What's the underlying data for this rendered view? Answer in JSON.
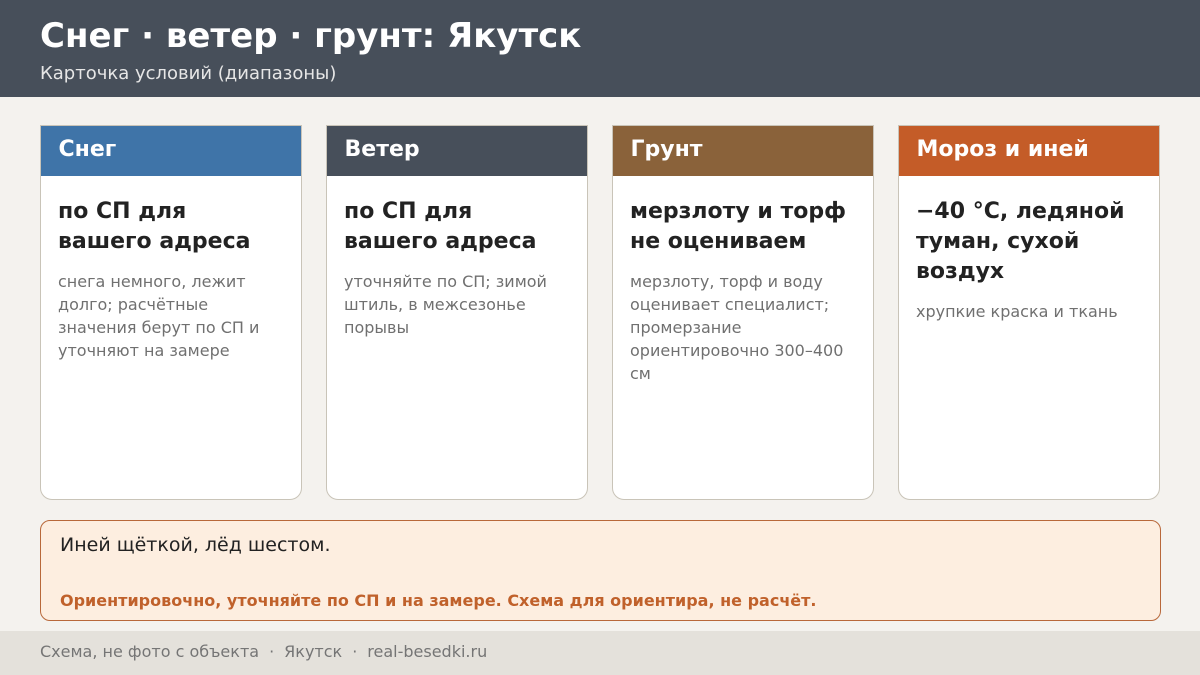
{
  "header": {
    "title": "Снег · ветер · грунт: Якутск",
    "subtitle": "Карточка условий (диапазоны)"
  },
  "colors": {
    "header_bg": "#474f5a",
    "snow": "#3f74a8",
    "wind": "#474f5a",
    "soil": "#8a623a",
    "frost": "#c45c28",
    "warning_text": "#c0612b"
  },
  "cards": [
    {
      "title": "Снег",
      "main": "по СП для вашего адреса",
      "desc": "снега немного, лежит долго; расчётные значения берут по СП и уточняют на замере"
    },
    {
      "title": "Ветер",
      "main": "по СП для вашего адреса",
      "desc": "уточняйте по СП; зимой штиль, в межсезонье порывы"
    },
    {
      "title": "Грунт",
      "main": "мерзлоту и торф не оцениваем",
      "desc": "мерзлоту, торф и воду оценивает специалист; промерзание ориентировочно 300–400 см"
    },
    {
      "title": "Мороз и иней",
      "main": "−40 °C, ледяной туман, сухой воздух",
      "desc": "хрупкие краска и ткань"
    }
  ],
  "note": {
    "main": "Иней щёткой, лёд шестом.",
    "warning": "Ориентировочно, уточняйте по СП и на замере. Схема для ориентира, не расчёт."
  },
  "footer": {
    "part1": "Схема, не фото с объекта",
    "separator": "·",
    "part2": "Якутск",
    "part3": "real-besedki.ru"
  }
}
